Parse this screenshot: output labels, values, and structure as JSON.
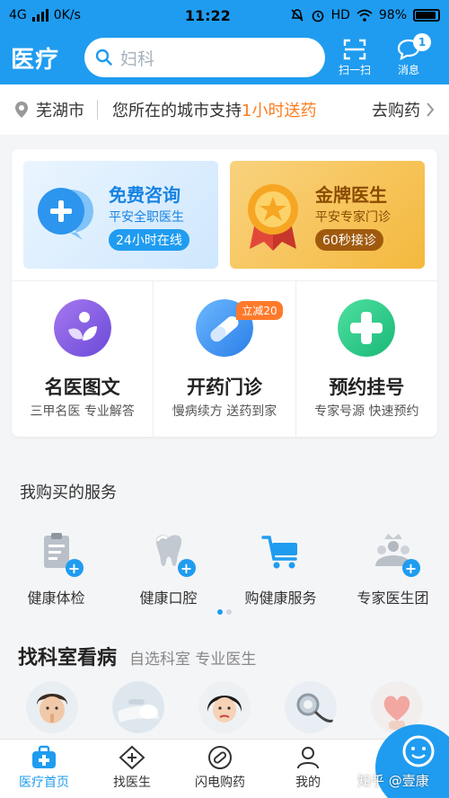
{
  "status_bar": {
    "network": "4G",
    "speed": "0K/s",
    "time": "11:22",
    "hd": "HD",
    "battery": "98%"
  },
  "header": {
    "logo": "医疗",
    "search_placeholder": "妇科",
    "scan_label": "扫一扫",
    "message_label": "消息",
    "message_badge": "1"
  },
  "location_bar": {
    "city": "芜湖市",
    "notice_prefix": "您所在的城市支持",
    "notice_highlight": "1小时送药",
    "action": "去购药"
  },
  "promos": [
    {
      "title": "免费咨询",
      "subtitle": "平安全职医生",
      "pill": "24小时在线"
    },
    {
      "title": "金牌医生",
      "subtitle": "平安专家门诊",
      "pill": "60秒接诊"
    }
  ],
  "services_grid": [
    {
      "title": "名医图文",
      "subtitle": "三甲名医 专业解答"
    },
    {
      "title": "开药门诊",
      "subtitle": "慢病续方 送药到家",
      "tag": "立减20"
    },
    {
      "title": "预约挂号",
      "subtitle": "专家号源 快速预约"
    }
  ],
  "purchased": {
    "title": "我购买的服务",
    "items": [
      {
        "label": "健康体检",
        "icon": "clipboard-icon"
      },
      {
        "label": "健康口腔",
        "icon": "tooth-icon"
      },
      {
        "label": "购健康服务",
        "icon": "cart-icon"
      },
      {
        "label": "专家医生团",
        "icon": "team-icon"
      }
    ],
    "page_index": 0,
    "page_count": 2
  },
  "departments": {
    "title": "找科室看病",
    "subtitle": "自选科室 专业医生"
  },
  "bottom_nav": [
    {
      "label": "医疗首页",
      "icon": "medkit-icon",
      "active": true
    },
    {
      "label": "找医生",
      "icon": "doctor-icon",
      "active": false
    },
    {
      "label": "闪电购药",
      "icon": "pill-icon",
      "active": false
    },
    {
      "label": "我的",
      "icon": "user-icon",
      "active": false
    }
  ],
  "watermark": "知乎 @壹康",
  "colors": {
    "primary": "#1f9cf0",
    "accent_orange": "#ff7d1f",
    "gold": "#f4b93e"
  }
}
